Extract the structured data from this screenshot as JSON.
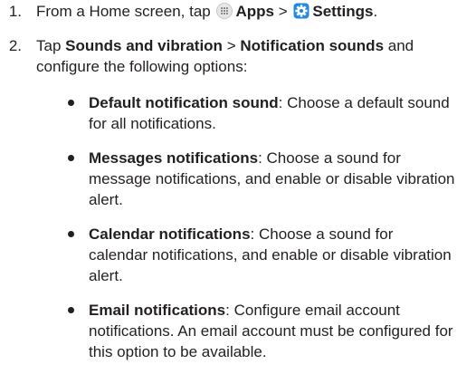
{
  "steps": [
    {
      "number": "1.",
      "prefix": "From a Home screen, tap",
      "apps_label": "Apps",
      "separator": ">",
      "settings_label": "Settings",
      "suffix": "."
    },
    {
      "number": "2.",
      "prefix": "Tap",
      "sounds_label": "Sounds and vibration",
      "separator": ">",
      "notif_label": "Notification sounds",
      "suffix": "and configure the following options:"
    }
  ],
  "options": [
    {
      "term": "Default notification sound",
      "desc": ": Choose a default sound for all notifications."
    },
    {
      "term": "Messages notifications",
      "desc": ": Choose a sound for message notifications, and enable or disable vibration alert."
    },
    {
      "term": "Calendar notifications",
      "desc": ": Choose a sound for calendar notifications, and enable or disable vibration alert."
    },
    {
      "term": "Email notifications",
      "desc": ": Configure email account notifications. An email account must be configured for this option to be available."
    }
  ],
  "icons": {
    "apps": "apps-grid-icon",
    "settings": "settings-gear-icon"
  },
  "colors": {
    "text": "#231f20",
    "settings_icon": "#1e88e5"
  }
}
